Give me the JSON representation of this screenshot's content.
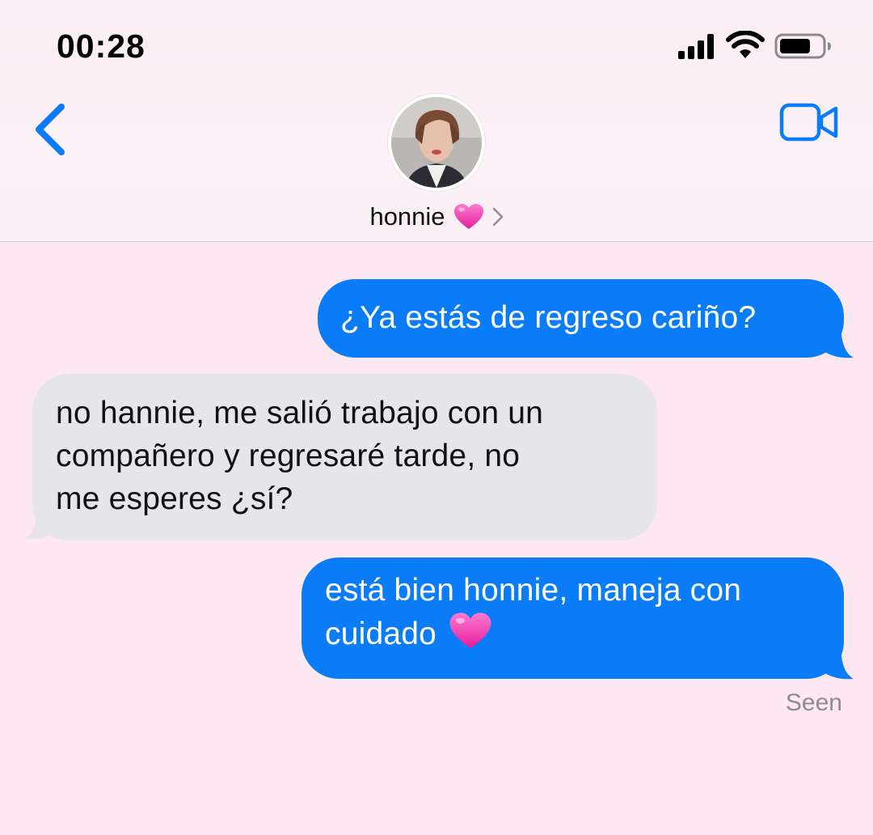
{
  "status_bar": {
    "time": "00:28",
    "icons": [
      "cellular-signal-icon",
      "wifi-icon",
      "battery-icon"
    ]
  },
  "nav": {
    "back_icon": "chevron-left-icon",
    "video_icon": "video-camera-icon",
    "contact_name": "honnie",
    "contact_emoji": "pink-heart-icon",
    "accent_color": "#0a7cf7"
  },
  "messages": [
    {
      "direction": "sent",
      "text": "¿Ya estás de regreso cariño?"
    },
    {
      "direction": "received",
      "lines": [
        "no hannie, me salió trabajo con un",
        "compañero y regresaré tarde, no",
        "me esperes ¿sí?"
      ]
    },
    {
      "direction": "sent",
      "lines": [
        "está bien honnie, maneja con",
        "cuidado"
      ],
      "emoji": "pink-heart-icon"
    }
  ],
  "read_receipt": "Seen",
  "colors": {
    "sent_bubble": "#0a7cf7",
    "received_bubble": "#e6e5ea",
    "background": "#fde8f1"
  }
}
